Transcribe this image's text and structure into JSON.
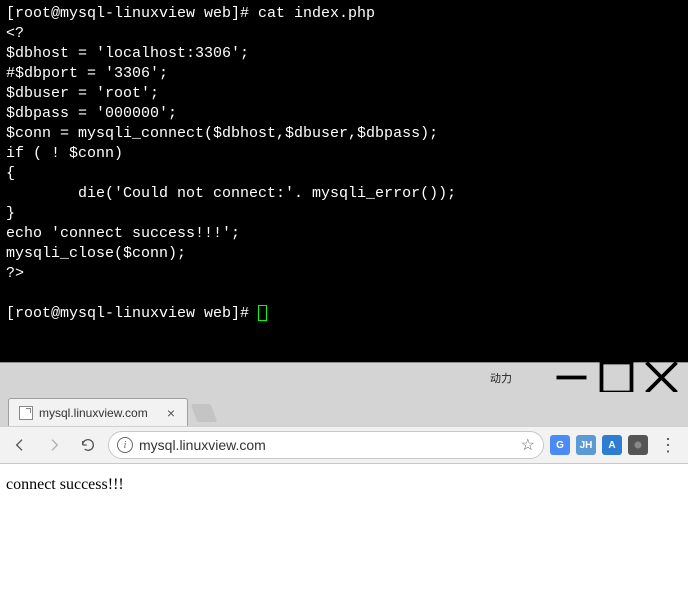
{
  "terminal": {
    "prompt_user": "root",
    "prompt_host": "mysql-linuxview",
    "prompt_cwd": "web",
    "lines": [
      "[root@mysql-linuxview web]# cat index.php",
      "<?",
      "$dbhost = 'localhost:3306';",
      "#$dbport = '3306';",
      "$dbuser = 'root';",
      "$dbpass = '000000';",
      "$conn = mysqli_connect($dbhost,$dbuser,$dbpass);",
      "if ( ! $conn)",
      "{",
      "        die('Could not connect:'. mysqli_error());",
      "}",
      "echo 'connect success!!!';",
      "mysqli_close($conn);",
      "?>",
      "",
      "[root@mysql-linuxview web]# "
    ]
  },
  "browser": {
    "titlebar_label": "动力",
    "tab": {
      "title": "mysql.linuxview.com"
    },
    "url": "mysql.linuxview.com",
    "page_text": "connect success!!!",
    "extensions": [
      {
        "label": "G",
        "bg": "#4c8bf5"
      },
      {
        "label": "JH",
        "bg": "#5b9bd5"
      },
      {
        "label": "A",
        "bg": "#2d7dd2"
      }
    ]
  }
}
